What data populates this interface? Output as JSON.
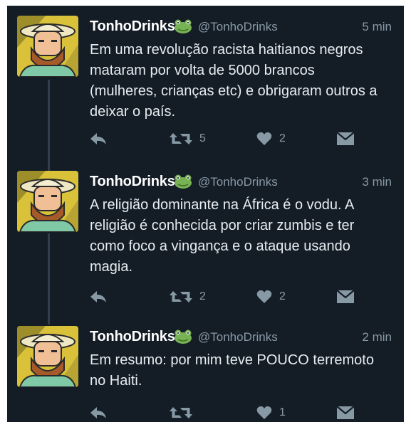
{
  "colors": {
    "background": "#141d26",
    "text": "#e6ecf0",
    "muted": "#8899a6",
    "icon": "#8899a6",
    "thread_line": "#2f3d4c"
  },
  "tweets": [
    {
      "display_name": "TonhoDrinks",
      "handle": "@TonhoDrinks",
      "time": "5 min",
      "text": "Em uma revolução racista haitianos negros\nmataram por volta de 5000 brancos\n(mulheres, crianças etc) e obrigaram outros a\ndeixar o país.",
      "retweets": "5",
      "likes": "2"
    },
    {
      "display_name": "TonhoDrinks",
      "handle": "@TonhoDrinks",
      "time": "3 min",
      "text": "A religião dominante na África é o vodu. A\nreligião é conhecida por criar zumbis e ter\ncomo foco a vingança e o ataque usando\nmagia.",
      "retweets": "2",
      "likes": "2"
    },
    {
      "display_name": "TonhoDrinks",
      "handle": "@TonhoDrinks",
      "time": "2 min",
      "text": "Em resumo: por mim teve POUCO terremoto\nno Haiti.",
      "retweets": "",
      "likes": "1"
    }
  ],
  "icons": [
    "reply-icon",
    "retweet-icon",
    "heart-icon",
    "direct-message-icon",
    "frog-emoji-icon"
  ]
}
